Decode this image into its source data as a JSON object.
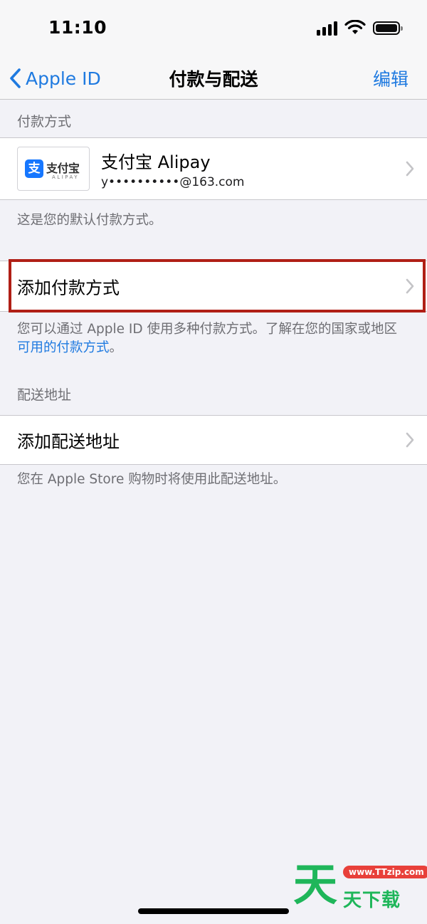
{
  "status_bar": {
    "time": "11:10"
  },
  "nav": {
    "back_label": "Apple ID",
    "title": "付款与配送",
    "edit_label": "编辑"
  },
  "payment": {
    "section_title": "付款方式",
    "method": {
      "logo_cn": "支付宝",
      "logo_en": "ALIPAY",
      "logo_mark": "支",
      "name": "支付宝 Alipay",
      "account": "y••••••••••@163.com"
    },
    "default_note": "这是您的默认付款方式。",
    "add_label": "添加付款方式",
    "info_prefix": "您可以通过 Apple ID 使用多种付款方式。了解在您的国家或地区",
    "info_link": "可用的付款方式",
    "info_suffix": "。"
  },
  "shipping": {
    "section_title": "配送地址",
    "add_label": "添加配送地址",
    "note": "您在 Apple Store 购物时将使用此配送地址。"
  },
  "watermark": {
    "url": "www.TTzip.com",
    "char_big": "天",
    "text": "天下载"
  },
  "colors": {
    "accent": "#1f7ae0",
    "highlight": "#b01f16",
    "background": "#f2f2f7",
    "watermark_green": "#1fb65a",
    "watermark_red": "#e8403a"
  }
}
